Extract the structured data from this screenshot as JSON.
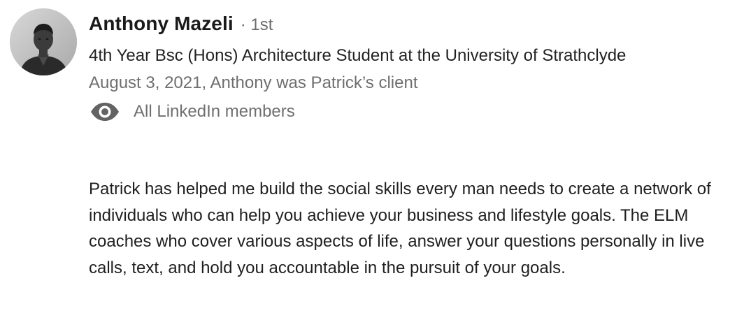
{
  "recommender": {
    "name": "Anthony Mazeli",
    "degree": "· 1st",
    "headline": "4th Year Bsc (Hons) Architecture Student at the University of Strathclyde",
    "relationship": "August 3, 2021, Anthony was Patrick’s client",
    "visibility": {
      "icon": "eye-icon",
      "label": "All LinkedIn members"
    }
  },
  "recommendation": {
    "text": "Patrick has helped me build the social skills every man needs to create a network of individuals who can help you achieve your business and lifestyle goals. The ELM coaches who cover various aspects of life, answer your questions personally in live calls, text, and hold you accountable in the pursuit of your goals."
  },
  "colors": {
    "name": "#1a1a1a",
    "secondary_text": "#6f6f6f",
    "body_text": "#1f1f1f",
    "background": "#ffffff"
  }
}
